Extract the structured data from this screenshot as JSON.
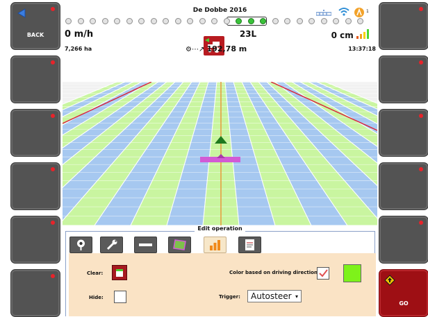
{
  "left_buttons": [
    {
      "label": "BACK",
      "icon": "back-arrow-icon"
    },
    {
      "label": ""
    },
    {
      "label": ""
    },
    {
      "label": ""
    },
    {
      "label": ""
    },
    {
      "label": ""
    }
  ],
  "right_buttons": [
    {
      "label": ""
    },
    {
      "label": ""
    },
    {
      "label": ""
    },
    {
      "label": ""
    },
    {
      "label": ""
    },
    {
      "label": "GO",
      "icon": "direction-sign-icon"
    }
  ],
  "status": {
    "title": "De Dobbe 2016",
    "speed": "0 m/h",
    "area": "7,266 ha",
    "center_value": "23L",
    "distance": "192,78 m",
    "offset": "0 cm",
    "time": "13:37:18"
  },
  "panel": {
    "title": "Edit operation",
    "clear_label": "Clear:",
    "hide_label": "Hide:",
    "color_label": "Color based on driving direction:",
    "trigger_label": "Trigger:",
    "trigger_value": "Autosteer",
    "color_swatch": "#7ef21a"
  },
  "colors": {
    "button_gray": "#535353",
    "go_red": "#9e0f14",
    "stripe_green": "#c9f5a0",
    "stripe_blue": "#a6c8f0",
    "panel_bg": "#fae3c5"
  }
}
